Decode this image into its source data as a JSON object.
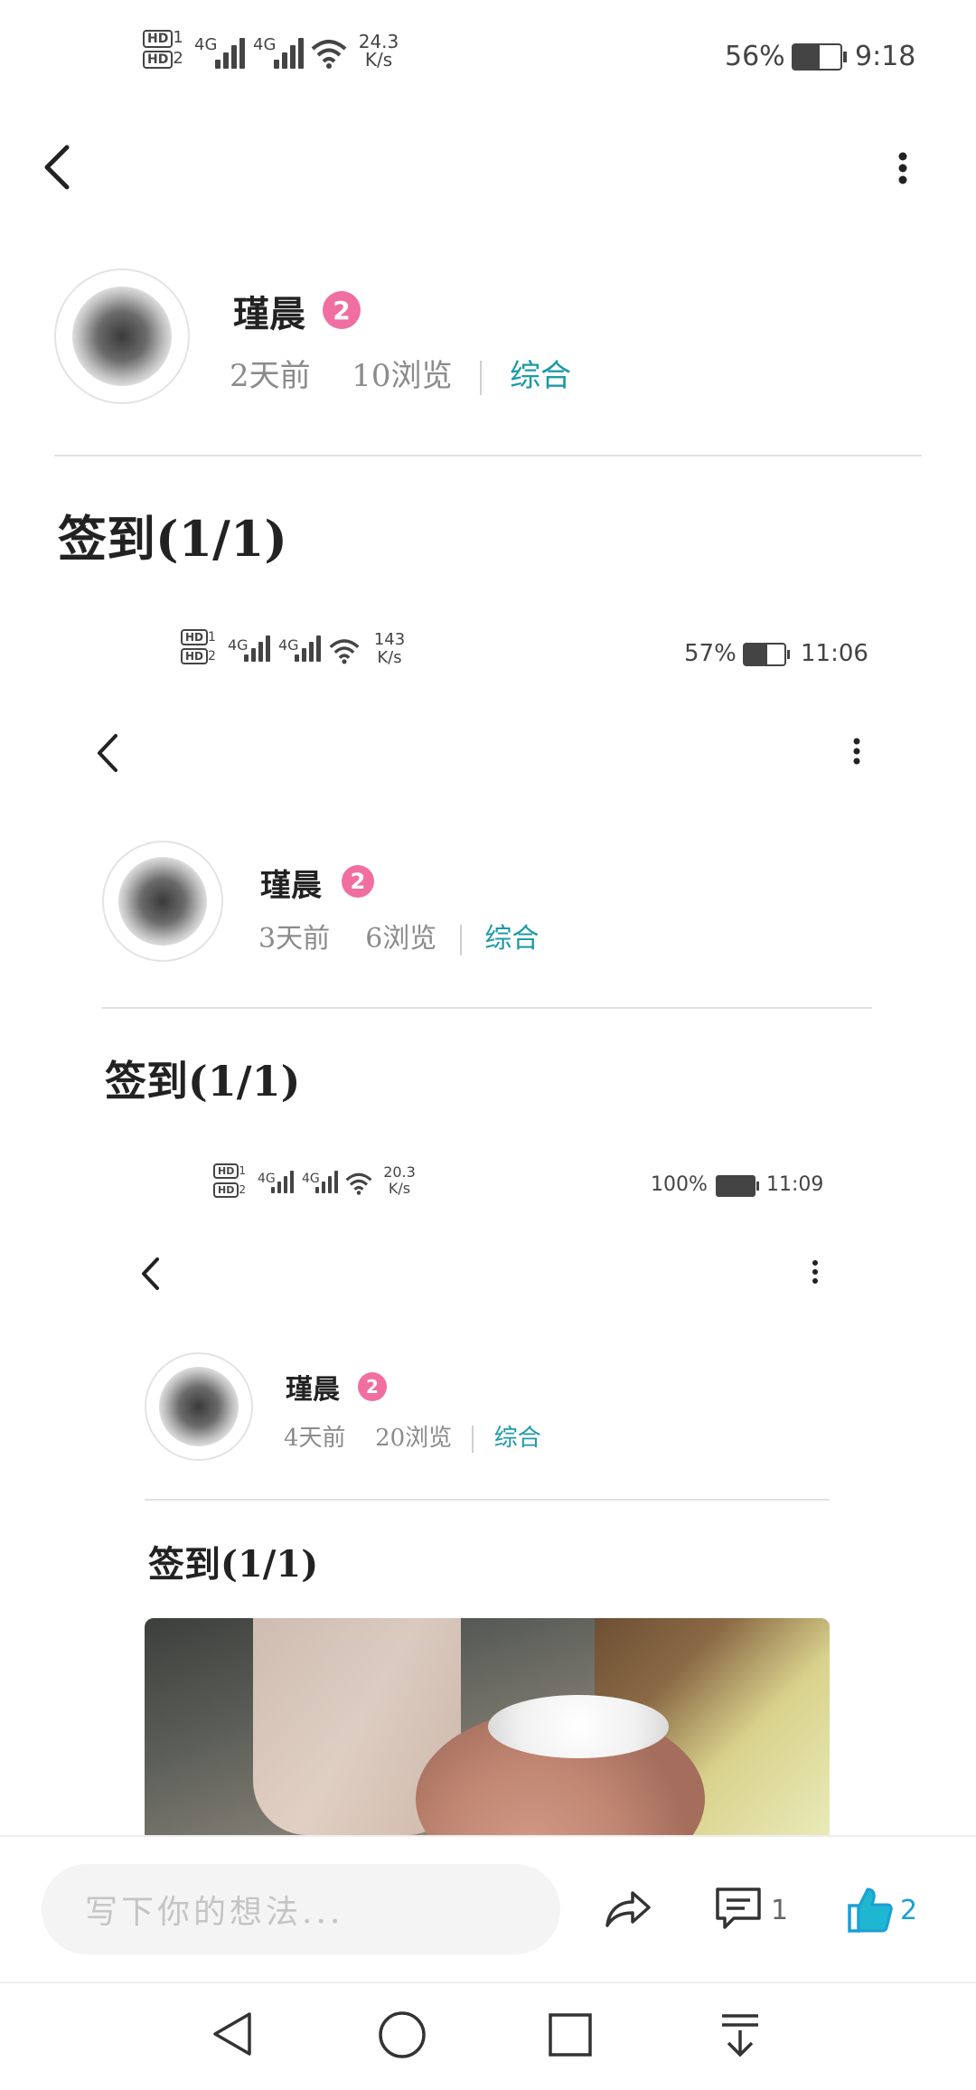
{
  "status_bar": {
    "hd1": "HD",
    "hd1_sub": "1",
    "hd2": "HD",
    "hd2_sub": "2",
    "net1": "4G",
    "net2": "4G",
    "speed": "24.3",
    "speed_unit": "K/s",
    "battery": "56%",
    "time": "9:18"
  },
  "post": {
    "author": "瑾晨",
    "level": "2",
    "age": "2天前",
    "views": "10浏览",
    "category": "综合",
    "title": "签到(1/1)"
  },
  "nested1": {
    "status": {
      "speed": "143",
      "speed_unit": "K/s",
      "battery": "57%",
      "time": "11:06",
      "net1": "4G",
      "net2": "4G",
      "hd1": "HD",
      "hd1_sub": "1",
      "hd2": "HD",
      "hd2_sub": "2"
    },
    "author": "瑾晨",
    "level": "2",
    "age": "3天前",
    "views": "6浏览",
    "category": "综合",
    "title": "签到(1/1)"
  },
  "nested2": {
    "status": {
      "speed": "20.3",
      "speed_unit": "K/s",
      "battery": "100%",
      "time": "11:09",
      "net1": "4G",
      "net2": "4G",
      "hd1": "HD",
      "hd1_sub": "1",
      "hd2": "HD",
      "hd2_sub": "2"
    },
    "author": "瑾晨",
    "level": "2",
    "age": "4天前",
    "views": "20浏览",
    "category": "综合",
    "title": "签到(1/1)"
  },
  "bottom_bar": {
    "comment_placeholder": "写下你的想法...",
    "comment_count": "1",
    "like_count": "2"
  },
  "colors": {
    "accent_teal": "#1e9aa8",
    "badge_pink": "#f06fa0",
    "like_blue": "#1b9fd6"
  },
  "icons": [
    "back-icon",
    "more-icon",
    "share-icon",
    "comment-icon",
    "like-icon",
    "nav-back-icon",
    "nav-home-icon",
    "nav-recent-icon",
    "nav-notification-icon"
  ]
}
